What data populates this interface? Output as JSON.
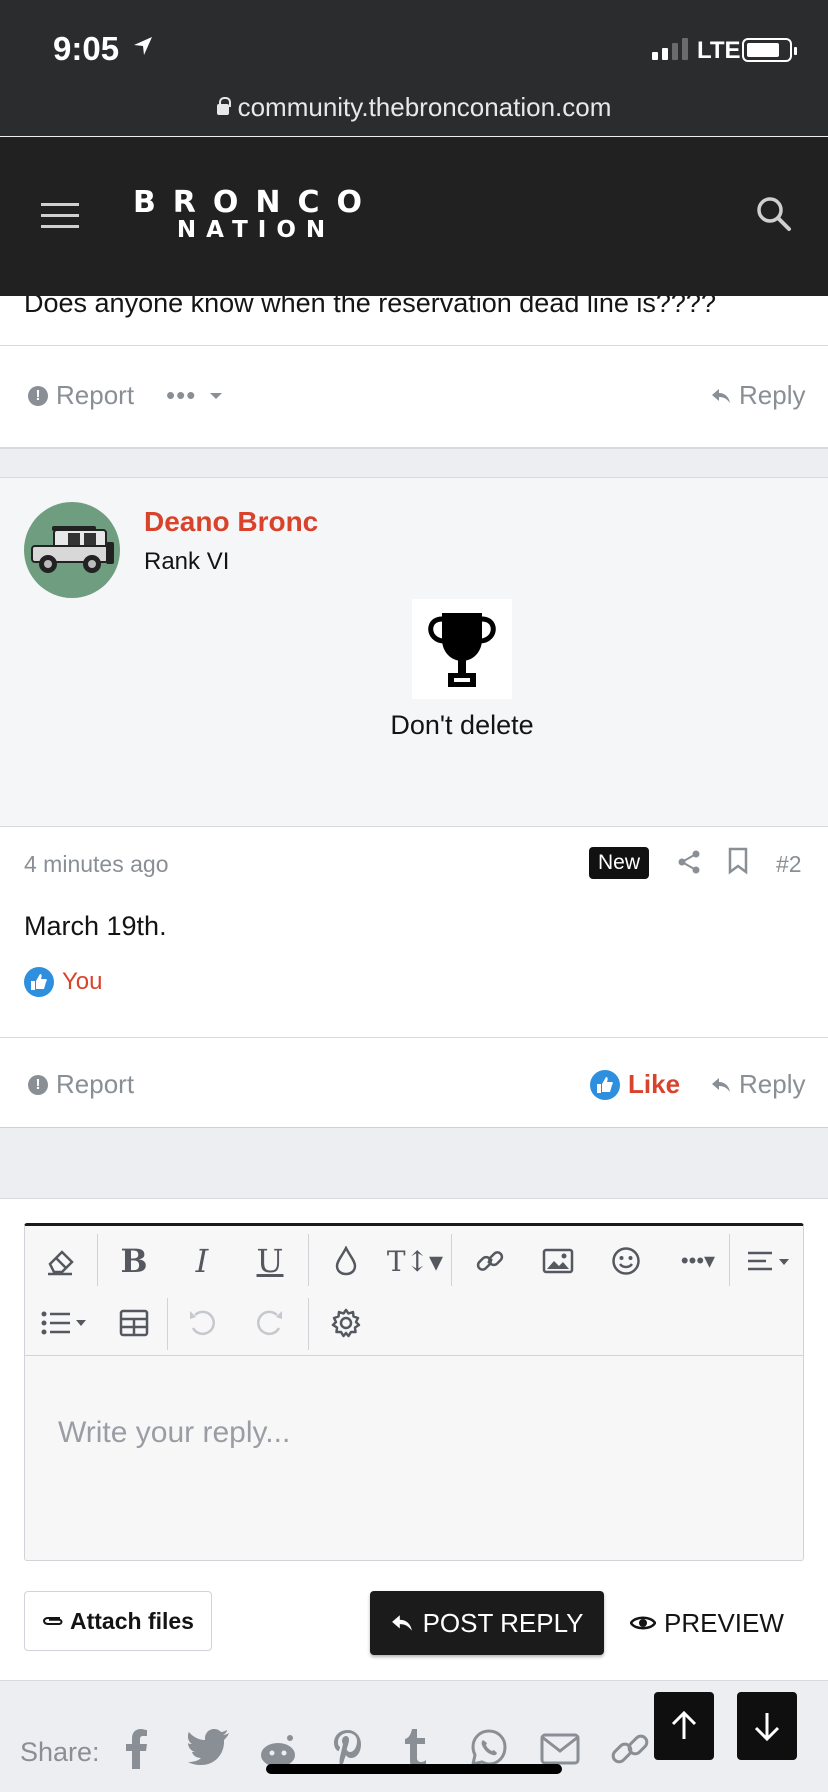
{
  "status_bar": {
    "time": "9:05",
    "network": "LTE"
  },
  "browser": {
    "url": "community.thebronconation.com"
  },
  "site": {
    "logo_line1": "BRONCO",
    "logo_line2": "NATION"
  },
  "post1": {
    "text": "Does anyone know when the reservation dead line is????",
    "report": "Report",
    "more": "•••",
    "reply": "Reply"
  },
  "user": {
    "name": "Deano Bronc",
    "rank": "Rank VI",
    "trophy_title": "Don't delete"
  },
  "post2": {
    "time": "4 minutes ago",
    "badge": "New",
    "number": "#2",
    "body": "March 19th.",
    "liked_by": "You",
    "report": "Report",
    "like": "Like",
    "reply": "Reply"
  },
  "editor": {
    "placeholder": "Write your reply...",
    "toolbar_icons": [
      "eraser-icon",
      "bold-icon",
      "italic-icon",
      "underline-icon",
      "color-drop-icon",
      "text-size-icon",
      "link-icon",
      "image-icon",
      "smile-icon",
      "more-icon",
      "align-icon",
      "list-icon",
      "table-icon",
      "undo-icon",
      "redo-icon",
      "settings-icon"
    ]
  },
  "actions": {
    "attach": "Attach files",
    "post_reply": "POST REPLY",
    "preview": "PREVIEW"
  },
  "share": {
    "label": "Share:",
    "icons": [
      "facebook-icon",
      "twitter-icon",
      "reddit-icon",
      "pinterest-icon",
      "tumblr-icon",
      "whatsapp-icon",
      "email-icon",
      "link-icon"
    ]
  },
  "colors": {
    "accent": "#d9432b",
    "like_blue": "#2d8fdd",
    "header": "#212122"
  }
}
